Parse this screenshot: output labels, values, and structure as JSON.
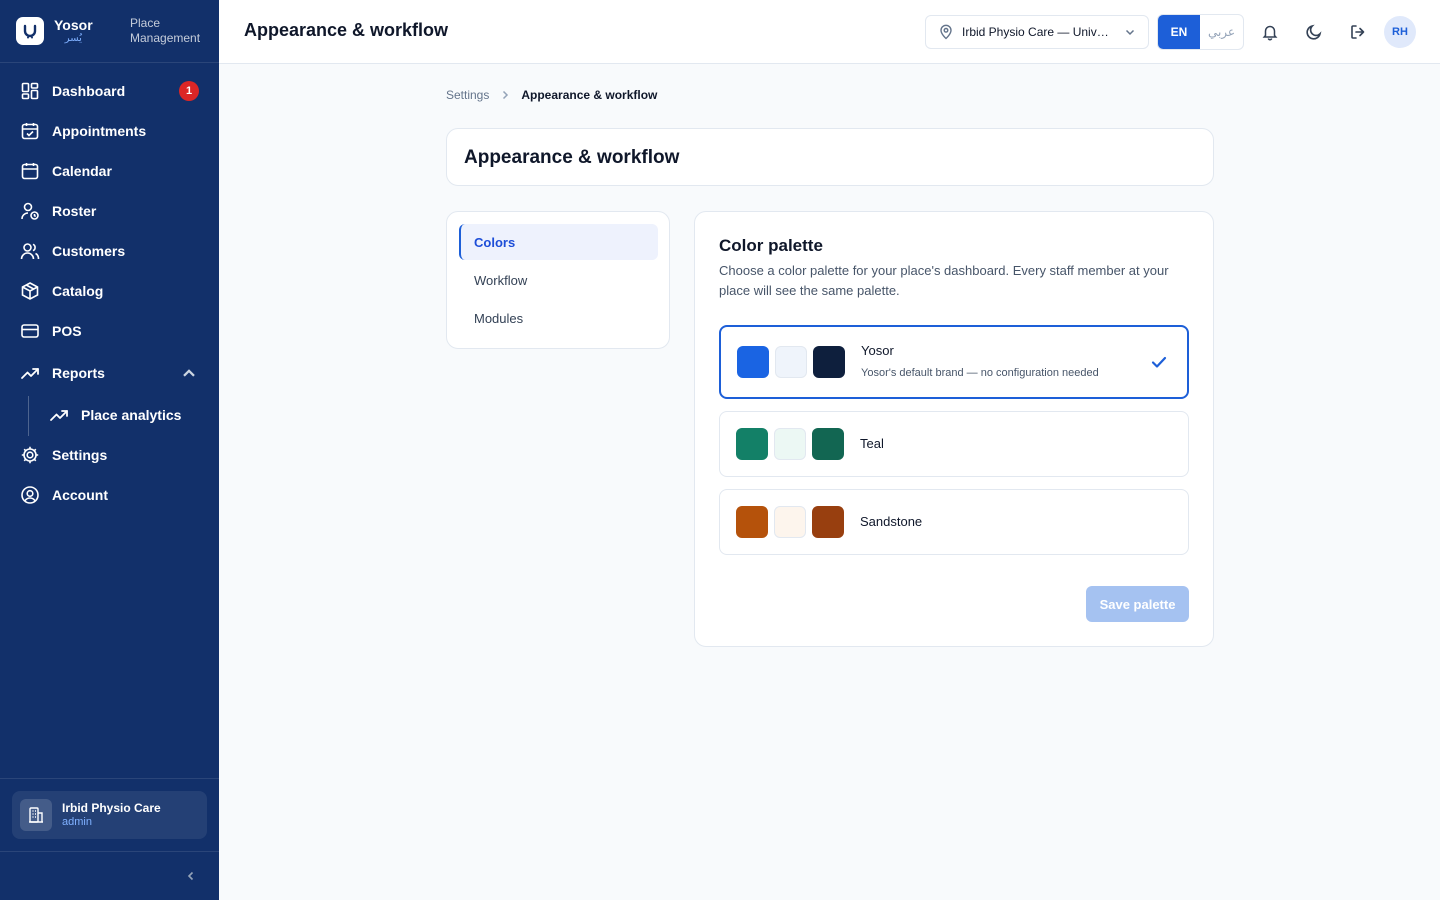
{
  "brand": {
    "name": "Yosor",
    "name_ar": "يُسر",
    "subtitle": "Place Management"
  },
  "sidebar": {
    "items": [
      {
        "label": "Dashboard",
        "icon": "dashboard-icon",
        "badge": "1"
      },
      {
        "label": "Appointments",
        "icon": "calendar-check-icon"
      },
      {
        "label": "Calendar",
        "icon": "calendar-icon"
      },
      {
        "label": "Roster",
        "icon": "user-clock-icon"
      },
      {
        "label": "Customers",
        "icon": "users-icon"
      },
      {
        "label": "Catalog",
        "icon": "box-icon"
      },
      {
        "label": "POS",
        "icon": "credit-card-icon"
      },
      {
        "label": "Reports",
        "icon": "trending-up-icon",
        "expanded": true
      },
      {
        "label": "Place analytics",
        "icon": "trending-up-icon"
      },
      {
        "label": "Settings",
        "icon": "gear-icon"
      },
      {
        "label": "Account",
        "icon": "user-circle-icon"
      }
    ],
    "place": {
      "name": "Irbid Physio Care",
      "role": "admin"
    }
  },
  "header": {
    "title": "Appearance & workflow",
    "place_select": "Irbid Physio Care — University Street",
    "lang_en": "EN",
    "lang_ar": "عربي",
    "avatar": "RH"
  },
  "breadcrumb": {
    "parent": "Settings",
    "current": "Appearance & workflow"
  },
  "page": {
    "title": "Appearance & workflow",
    "tabs": [
      {
        "label": "Colors",
        "active": true
      },
      {
        "label": "Workflow",
        "active": false
      },
      {
        "label": "Modules",
        "active": false
      }
    ]
  },
  "palette": {
    "title": "Color palette",
    "description": "Choose a color palette for your place's dashboard. Every staff member at your place will see the same palette.",
    "options": [
      {
        "name": "Yosor",
        "description": "Yosor's default brand — no configuration needed",
        "selected": true,
        "colors": [
          "#1a64e3",
          "#eff4fb",
          "#0e1f3d"
        ]
      },
      {
        "name": "Teal",
        "description": "",
        "selected": false,
        "colors": [
          "#138067",
          "#ecf8f4",
          "#126652"
        ]
      },
      {
        "name": "Sandstone",
        "description": "",
        "selected": false,
        "colors": [
          "#b5520b",
          "#fdf5ed",
          "#983f0f"
        ]
      }
    ],
    "save_label": "Save palette"
  },
  "colors": {
    "sidebar_bg": "#12306a",
    "accent": "#1d5fd8",
    "badge": "#dc2626"
  }
}
